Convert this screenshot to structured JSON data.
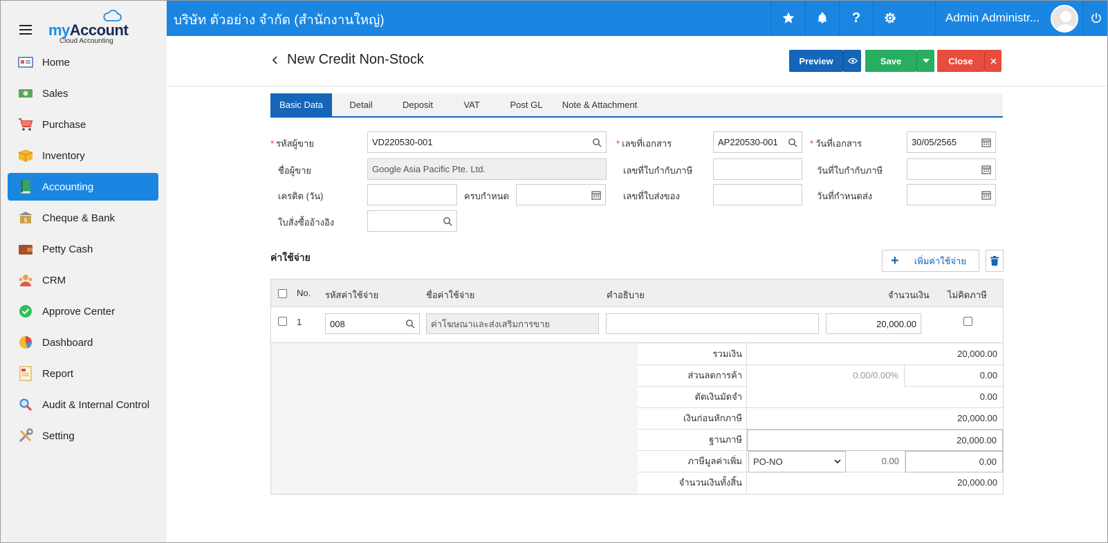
{
  "app": {
    "logo_my": "my",
    "logo_account": "Account",
    "logo_sub": "Cloud Accounting"
  },
  "sidebar": {
    "items": [
      {
        "label": "Home",
        "icon": "home-icon",
        "active": false
      },
      {
        "label": "Sales",
        "icon": "cash-icon",
        "active": false
      },
      {
        "label": "Purchase",
        "icon": "cart-icon",
        "active": false
      },
      {
        "label": "Inventory",
        "icon": "box-icon",
        "active": false
      },
      {
        "label": "Accounting",
        "icon": "book-icon",
        "active": true
      },
      {
        "label": "Cheque & Bank",
        "icon": "bank-icon",
        "active": false
      },
      {
        "label": "Petty Cash",
        "icon": "wallet-icon",
        "active": false
      },
      {
        "label": "CRM",
        "icon": "crm-icon",
        "active": false
      },
      {
        "label": "Approve Center",
        "icon": "check-circle-icon",
        "active": false
      },
      {
        "label": "Dashboard",
        "icon": "pie-chart-icon",
        "active": false
      },
      {
        "label": "Report",
        "icon": "report-icon",
        "active": false
      },
      {
        "label": "Audit & Internal Control",
        "icon": "magnifier-icon",
        "active": false
      },
      {
        "label": "Setting",
        "icon": "tools-icon",
        "active": false
      }
    ]
  },
  "topbar": {
    "company": "บริษัท ตัวอย่าง จำกัด (สำนักงานใหญ่)",
    "user": "Admin Administr...",
    "accent": "#1a86e2"
  },
  "page": {
    "title": "New Credit Non-Stock",
    "preview": "Preview",
    "save": "Save",
    "close": "Close"
  },
  "tabs": [
    "Basic Data",
    "Detail",
    "Deposit",
    "VAT",
    "Post GL",
    "Note & Attachment"
  ],
  "form": {
    "vendor_code_label": "รหัสผู้ขาย",
    "vendor_code": "VD220530-001",
    "vendor_name_label": "ชื่อผู้ขาย",
    "vendor_name": "Google Asia Pacific Pte. Ltd.",
    "credit_days_label": "เครดิต (วัน)",
    "credit_days": "",
    "due_label": "ครบกำหนด",
    "due": "",
    "po_ref_label": "ใบสั่งซื้ออ้างอิง",
    "po_ref": "",
    "doc_no_label": "เลขที่เอกสาร",
    "doc_no": "AP220530-001",
    "tax_inv_no_label": "เลขที่ใบกำกับภาษี",
    "tax_inv_no": "",
    "delivery_no_label": "เลขที่ใบส่งของ",
    "delivery_no": "",
    "doc_date_label": "วันที่เอกสาร",
    "doc_date": "30/05/2565",
    "tax_inv_date_label": "วันที่ใบกำกับภาษี",
    "tax_inv_date": "",
    "delivery_date_label": "วันที่กำหนดส่ง",
    "delivery_date": ""
  },
  "expenses": {
    "title": "ค่าใช้จ่าย",
    "add_label": "เพิ่มค่าใช้จ่าย",
    "columns": {
      "no": "No.",
      "code": "รหัสค่าใช้จ่าย",
      "name": "ชื่อค่าใช้จ่าย",
      "desc": "คำอธิบาย",
      "amount": "จำนวนเงิน",
      "no_tax": "ไม่คิดภาษี"
    },
    "rows": [
      {
        "no": "1",
        "code": "008",
        "name": "ค่าโฆษณาและส่งเสริมการขาย",
        "desc": "",
        "amount": "20,000.00"
      }
    ]
  },
  "summary": {
    "total_label": "รวมเงิน",
    "total": "20,000.00",
    "discount_label": "ส่วนลดการค้า",
    "discount_pct": "0.00/0.00%",
    "discount": "0.00",
    "deposit_label": "ตัดเงินมัดจำ",
    "deposit": "0.00",
    "pre_tax_label": "เงินก่อนหักภาษี",
    "pre_tax": "20,000.00",
    "tax_base_label": "ฐานภาษี",
    "tax_base": "20,000.00",
    "vat_label": "ภาษีมูลค่าเพิ่ม",
    "vat_type": "PO-NO",
    "vat_rate": "0.00",
    "vat": "0.00",
    "grand_total_label": "จำนวนเงินทั้งสิ้น",
    "grand_total": "20,000.00"
  }
}
